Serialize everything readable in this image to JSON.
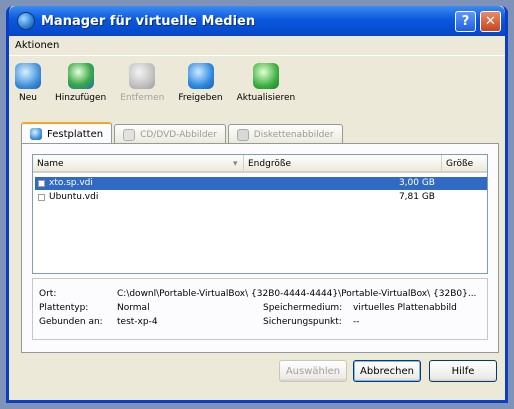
{
  "window": {
    "title": "Manager für virtuelle Medien"
  },
  "menubar": {
    "items": [
      "Aktionen"
    ]
  },
  "toolbar": {
    "items": [
      {
        "label": "Neu",
        "icon": "new-disk-icon",
        "enabled": true
      },
      {
        "label": "Hinzufügen",
        "icon": "add-disk-icon",
        "enabled": true
      },
      {
        "label": "Entfernen",
        "icon": "remove-disk-icon",
        "enabled": false
      },
      {
        "label": "Freigeben",
        "icon": "release-disk-icon",
        "enabled": true
      },
      {
        "label": "Aktualisieren",
        "icon": "refresh-icon",
        "enabled": true
      }
    ]
  },
  "tabs": [
    {
      "label": "Festplatten",
      "active": true
    },
    {
      "label": "CD/DVD-Abbilder",
      "active": false
    },
    {
      "label": "Diskettenabbilder",
      "active": false
    }
  ],
  "list": {
    "columns": {
      "name": "Name",
      "end_size": "Endgröße",
      "size": "Größe"
    },
    "rows": [
      {
        "name": "xto.sp.vdi",
        "size": "3,00 GB",
        "selected": true
      },
      {
        "name": "Ubuntu.vdi",
        "size": "7,81 GB",
        "selected": false
      }
    ]
  },
  "details": {
    "location_label": "Ort:",
    "location_value": "C:\\downl\\Portable-VirtualBox\\ {32B0-4444-4444}\\Portable-VirtualBox\\ {32B0}...",
    "type_label": "Plattentyp:",
    "type_value": "Normal",
    "attached_label": "Gebunden an:",
    "attached_value": "test-xp-4",
    "storage_label": "Speichermedium:",
    "storage_value": "virtuelles Plattenabbild",
    "snapshot_label": "Sicherungspunkt:",
    "snapshot_value": "--"
  },
  "buttons": {
    "select": "Auswählen",
    "cancel": "Abbrechen",
    "help": "Hilfe"
  },
  "colors": {
    "titlebar": "#0a58dd",
    "selection": "#316ac5",
    "active_tab_accent": "#f5a623"
  }
}
